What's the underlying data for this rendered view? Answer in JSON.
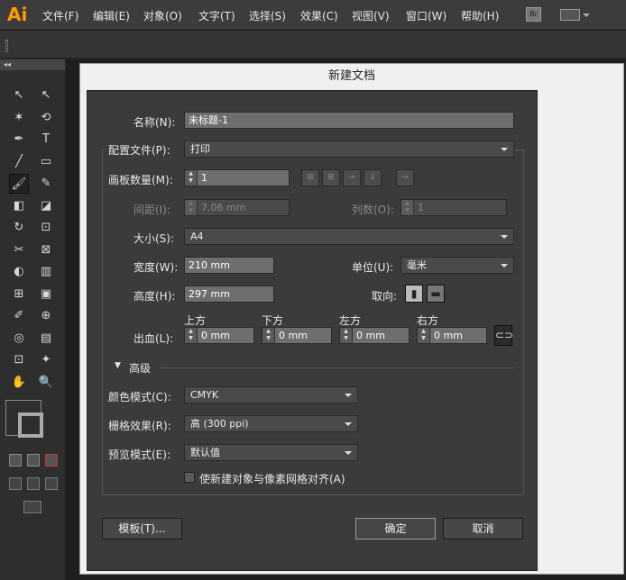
{
  "app": {
    "logo": "Ai",
    "menus": [
      "文件(F)",
      "编辑(E)",
      "对象(O)",
      "文字(T)",
      "选择(S)",
      "效果(C)",
      "视图(V)",
      "窗口(W)",
      "帮助(H)"
    ],
    "bridge_label": "Br"
  },
  "toolbar_header": "◂◂",
  "tools": [
    "↖",
    "↖",
    "✶",
    "⟲",
    "✒",
    "T",
    "╱",
    "▭",
    "🖌",
    "✎",
    "◧",
    "◪",
    "↻",
    "⊡",
    "✂",
    "⊠",
    "◐",
    "▥",
    "⊞",
    "▣",
    "✐",
    "⊕",
    "◎",
    "▤",
    "⊡",
    "✦",
    "✋",
    "🔍"
  ],
  "dialog": {
    "title": "新建文档",
    "name_label": "名称(N):",
    "name_value": "未标题-1",
    "profile_label": "配置文件(P):",
    "profile_value": "打印",
    "artboards_label": "画板数量(M):",
    "artboards_value": "1",
    "spacing_label": "间距(I):",
    "spacing_value": "7.06 mm",
    "columns_label": "列数(O):",
    "columns_value": "1",
    "size_label": "大小(S):",
    "size_value": "A4",
    "width_label": "宽度(W):",
    "width_value": "210 mm",
    "units_label": "单位(U):",
    "units_value": "毫米",
    "height_label": "高度(H):",
    "height_value": "297 mm",
    "orientation_label": "取向:",
    "bleed_label": "出血(L):",
    "bleed_top_label": "上方",
    "bleed_top_value": "0 mm",
    "bleed_bottom_label": "下方",
    "bleed_bottom_value": "0 mm",
    "bleed_left_label": "左方",
    "bleed_left_value": "0 mm",
    "bleed_right_label": "右方",
    "bleed_right_value": "0 mm",
    "advanced_label": "高级",
    "color_mode_label": "颜色模式(C):",
    "color_mode_value": "CMYK",
    "raster_label": "栅格效果(R):",
    "raster_value": "高 (300 ppi)",
    "preview_label": "预览模式(E):",
    "preview_value": "默认值",
    "align_label": "使新建对象与像素网格对齐(A)",
    "templates_button": "模板(T)...",
    "ok_button": "确定",
    "cancel_button": "取消"
  }
}
